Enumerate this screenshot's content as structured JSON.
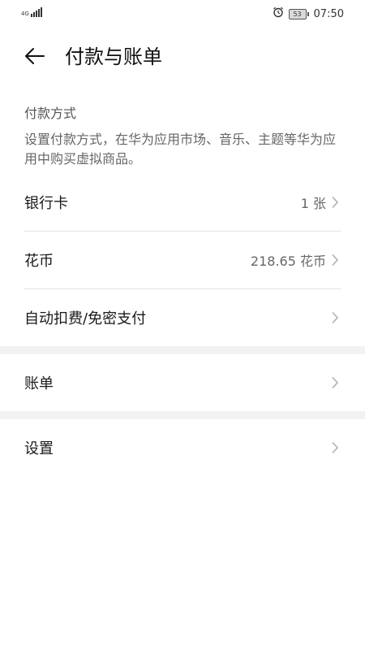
{
  "status_bar": {
    "network": "4G",
    "battery": "53",
    "time": "07:50",
    "icons": [
      "signal-icon",
      "alarm-icon",
      "battery-icon"
    ]
  },
  "header": {
    "title": "付款与账单",
    "back_icon": "arrow-left-icon"
  },
  "payment_section": {
    "title": "付款方式",
    "description": "设置付款方式，在华为应用市场、音乐、主题等华为应用中购买虚拟商品。"
  },
  "payment_items": [
    {
      "label": "银行卡",
      "value": "1 张"
    },
    {
      "label": "花币",
      "value": "218.65 花币"
    },
    {
      "label": "自动扣费/免密支付",
      "value": ""
    }
  ],
  "bill_item": {
    "label": "账单"
  },
  "settings_item": {
    "label": "设置"
  },
  "colors": {
    "background": "#ffffff",
    "section_gap": "#f2f2f2",
    "divider": "#e4e4e4",
    "chevron": "#b0b0b0"
  }
}
